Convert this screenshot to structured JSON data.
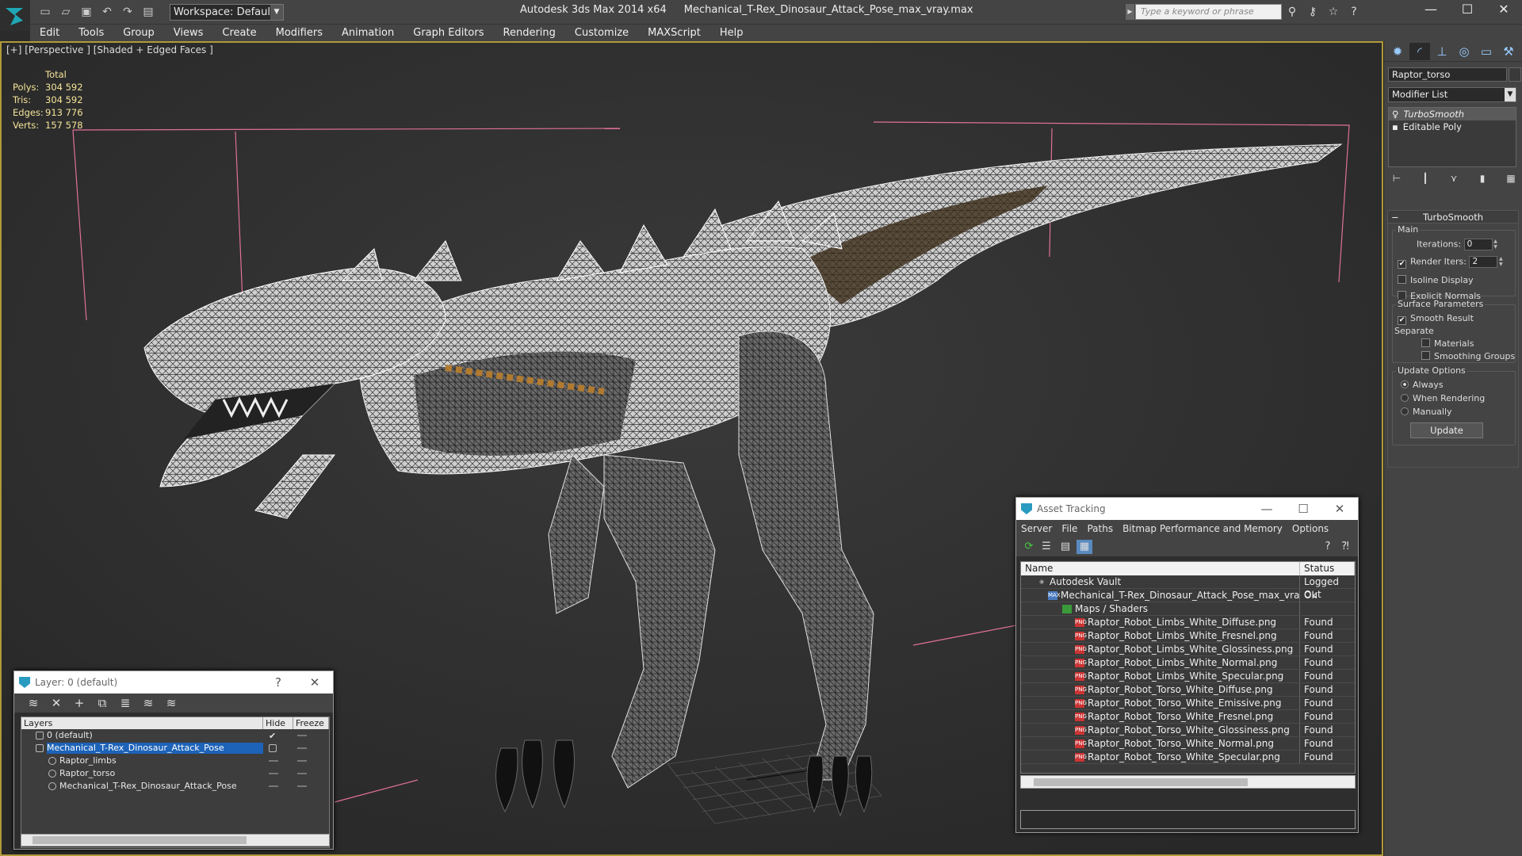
{
  "titlebar": {
    "workspace": "Workspace: Default",
    "app": "Autodesk 3ds Max  2014 x64",
    "file": "Mechanical_T-Rex_Dinosaur_Attack_Pose_max_vray.max",
    "search_placeholder": "Type a keyword or phrase",
    "quick_access_icons": [
      "new-icon",
      "open-icon",
      "save-icon",
      "undo-icon",
      "redo-icon",
      "project-icon"
    ],
    "help_icons": [
      "binoculars-icon",
      "key-icon",
      "star-icon",
      "help-icon"
    ]
  },
  "menu": [
    "Edit",
    "Tools",
    "Group",
    "Views",
    "Create",
    "Modifiers",
    "Animation",
    "Graph Editors",
    "Rendering",
    "Customize",
    "MAXScript",
    "Help"
  ],
  "viewport": {
    "label": "[+] [Perspective ] [Shaded + Edged Faces ]",
    "stats_header": "Total",
    "stats": [
      {
        "k": "Polys:",
        "v": "304 592"
      },
      {
        "k": "Tris:",
        "v": "304 592"
      },
      {
        "k": "Edges:",
        "v": "913 776"
      },
      {
        "k": "Verts:",
        "v": "157 578"
      }
    ]
  },
  "command_panel": {
    "tabs": [
      "create-icon",
      "modify-icon",
      "hierarchy-icon",
      "motion-icon",
      "display-icon",
      "utilities-icon"
    ],
    "object_name": "Raptor_torso",
    "modifier_list": "Modifier List",
    "stack": [
      "TurboSmooth",
      "Editable Poly"
    ],
    "rollout_title": "TurboSmooth",
    "main_label": "Main",
    "iterations_label": "Iterations:",
    "iterations": "0",
    "render_iters_label": "Render Iters:",
    "render_iters": "2",
    "isoline": "Isoline Display",
    "explicit": "Explicit Normals",
    "surface_params": "Surface Parameters",
    "smooth_result": "Smooth Result",
    "separate": "Separate",
    "materials": "Materials",
    "smoothing_groups": "Smoothing Groups",
    "update_options": "Update Options",
    "always": "Always",
    "when_rendering": "When Rendering",
    "manually": "Manually",
    "update_btn": "Update"
  },
  "layer_window": {
    "title": "Layer: 0 (default)",
    "help": "?",
    "close": "✕",
    "cols": [
      "Layers",
      "Hide",
      "Freeze"
    ],
    "rows": [
      "0 (default)",
      "Mechanical_T-Rex_Dinosaur_Attack_Pose",
      "Raptor_limbs",
      "Raptor_torso",
      "Mechanical_T-Rex_Dinosaur_Attack_Pose"
    ]
  },
  "asset_window": {
    "title": "Asset Tracking",
    "menu": [
      "Server",
      "File",
      "Paths",
      "Bitmap Performance and Memory",
      "Options"
    ],
    "cols": [
      "Name",
      "Status"
    ],
    "rows": [
      {
        "name": "Autodesk Vault",
        "status": "Logged Out"
      },
      {
        "name": "Mechanical_T-Rex_Dinosaur_Attack_Pose_max_vray.max",
        "status": "Ok"
      },
      {
        "name": "Maps / Shaders",
        "status": ""
      },
      {
        "name": "Raptor_Robot_Limbs_White_Diffuse.png",
        "status": "Found"
      },
      {
        "name": "Raptor_Robot_Limbs_White_Fresnel.png",
        "status": "Found"
      },
      {
        "name": "Raptor_Robot_Limbs_White_Glossiness.png",
        "status": "Found"
      },
      {
        "name": "Raptor_Robot_Limbs_White_Normal.png",
        "status": "Found"
      },
      {
        "name": "Raptor_Robot_Limbs_White_Specular.png",
        "status": "Found"
      },
      {
        "name": "Raptor_Robot_Torso_White_Diffuse.png",
        "status": "Found"
      },
      {
        "name": "Raptor_Robot_Torso_White_Emissive.png",
        "status": "Found"
      },
      {
        "name": "Raptor_Robot_Torso_White_Fresnel.png",
        "status": "Found"
      },
      {
        "name": "Raptor_Robot_Torso_White_Glossiness.png",
        "status": "Found"
      },
      {
        "name": "Raptor_Robot_Torso_White_Normal.png",
        "status": "Found"
      },
      {
        "name": "Raptor_Robot_Torso_White_Specular.png",
        "status": "Found"
      }
    ]
  },
  "colors": {
    "selection": "#1d63b8",
    "viewport_border": "#b09a3a",
    "stats": "#f5e49a"
  }
}
